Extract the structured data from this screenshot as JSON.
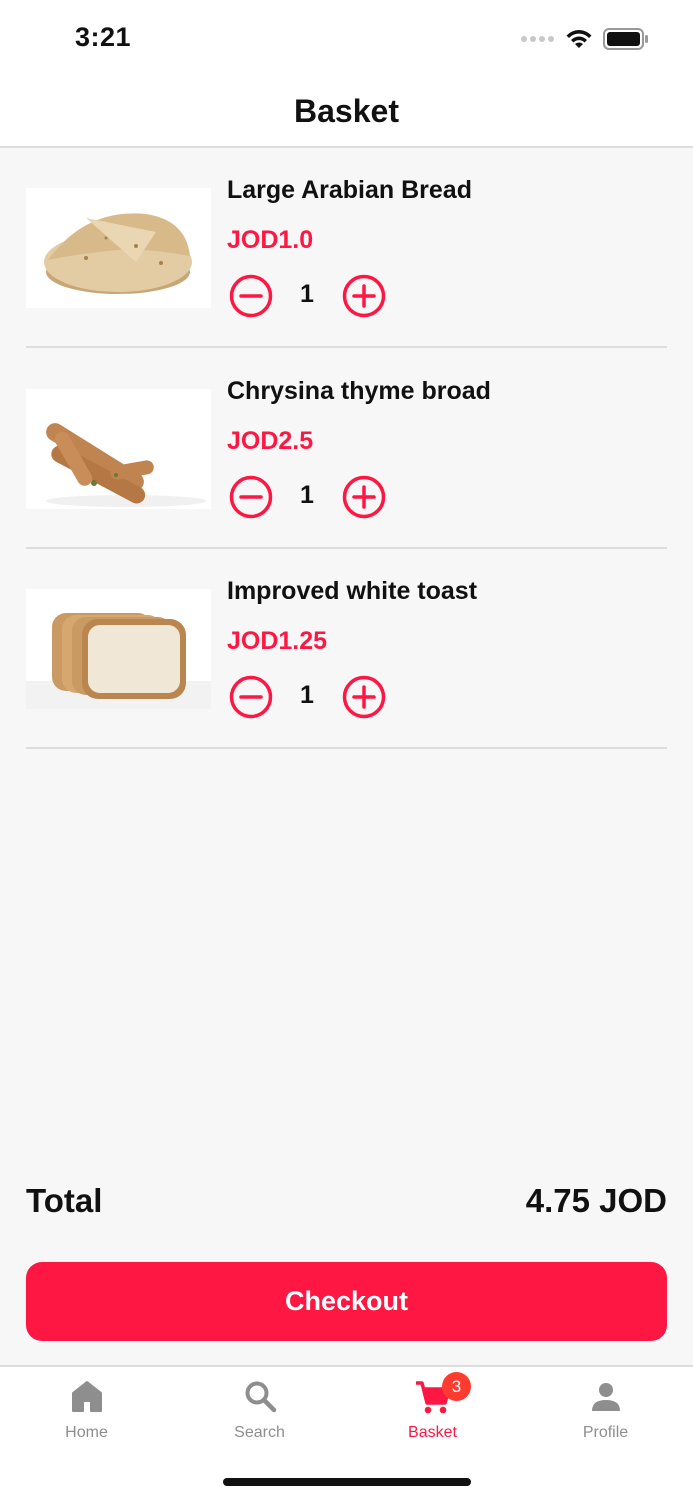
{
  "status_bar": {
    "time": "3:21"
  },
  "nav": {
    "title": "Basket"
  },
  "items": [
    {
      "name": "Large Arabian Bread",
      "price": "JOD1.0",
      "quantity": "1"
    },
    {
      "name": "Chrysina thyme broad",
      "price": "JOD2.5",
      "quantity": "1"
    },
    {
      "name": "Improved white toast",
      "price": "JOD1.25",
      "quantity": "1"
    }
  ],
  "summary": {
    "total_label": "Total",
    "total_value": "4.75 JOD"
  },
  "checkout": {
    "label": "Checkout"
  },
  "tabs": [
    {
      "label": "Home",
      "icon": "home-icon"
    },
    {
      "label": "Search",
      "icon": "search-icon"
    },
    {
      "label": "Basket",
      "icon": "cart-icon",
      "badge": "3",
      "active": true
    },
    {
      "label": "Profile",
      "icon": "person-icon"
    }
  ],
  "colors": {
    "accent": "#ff1744",
    "badge": "#ff3b30",
    "inactive": "#8e8e8e"
  }
}
